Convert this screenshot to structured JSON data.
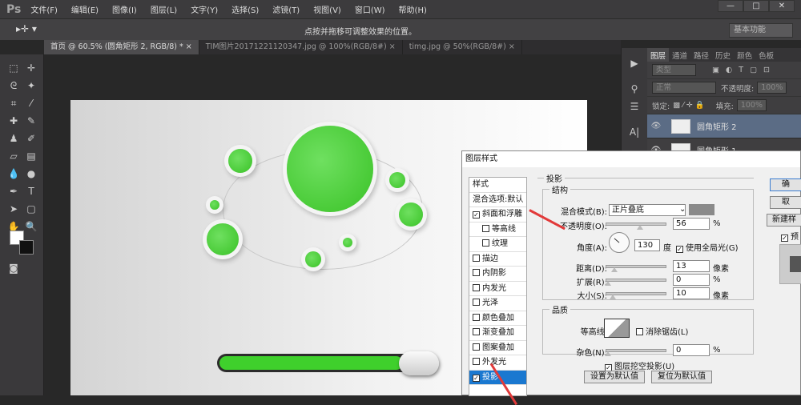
{
  "app": {
    "logo": "Ps",
    "menu": [
      "文件(F)",
      "编辑(E)",
      "图像(I)",
      "图层(L)",
      "文字(Y)",
      "选择(S)",
      "滤镜(T)",
      "视图(V)",
      "窗口(W)",
      "帮助(H)"
    ],
    "window_controls": [
      "—",
      "□",
      "✕"
    ]
  },
  "options": {
    "hint": "点按并拖移可调整效果的位置。",
    "workspace": "基本功能"
  },
  "tabs": [
    {
      "label": "首页 @ 60.5% (圆角矩形 2, RGB/8) *",
      "close": "×"
    },
    {
      "label": "TIM图片20171221120347.jpg @ 100%(RGB/8#)",
      "close": "×"
    },
    {
      "label": "timg.jpg @ 50%(RGB/8#)",
      "close": "×"
    }
  ],
  "canvas": {
    "progress_percent": 85,
    "accent": "#3fd02c"
  },
  "layers_panel": {
    "tabs": [
      "图层",
      "通道",
      "路径",
      "历史",
      "颜色",
      "色板"
    ],
    "filter": "类型",
    "blend": "正常",
    "opacity_label": "不透明度:",
    "opacity": "100%",
    "lock_label": "锁定:",
    "fill_label": "填充:",
    "fill": "100%",
    "layers": [
      {
        "name": "圆角矩形 2",
        "selected": true
      },
      {
        "name": "圆角矩形 1",
        "selected": false
      }
    ]
  },
  "dialog": {
    "title": "图层样式",
    "styles_header": "样式",
    "blend_options": "混合选项:默认",
    "styles": [
      {
        "label": "斜面和浮雕",
        "checked": true,
        "sub": false
      },
      {
        "label": "等高线",
        "checked": false,
        "sub": true
      },
      {
        "label": "纹理",
        "checked": false,
        "sub": true
      },
      {
        "label": "描边",
        "checked": false,
        "sub": false
      },
      {
        "label": "内阴影",
        "checked": false,
        "sub": false
      },
      {
        "label": "内发光",
        "checked": false,
        "sub": false
      },
      {
        "label": "光泽",
        "checked": false,
        "sub": false
      },
      {
        "label": "颜色叠加",
        "checked": false,
        "sub": false
      },
      {
        "label": "渐变叠加",
        "checked": false,
        "sub": false
      },
      {
        "label": "图案叠加",
        "checked": false,
        "sub": false
      },
      {
        "label": "外发光",
        "checked": false,
        "sub": false
      },
      {
        "label": "投影",
        "checked": true,
        "sub": false,
        "selected": true
      }
    ],
    "section": "投影",
    "structure": "结构",
    "blend_mode_label": "混合模式(B):",
    "blend_mode": "正片叠底",
    "shadow_color": "#8a8a8a",
    "opacity_label": "不透明度(O):",
    "opacity": "56",
    "angle_label": "角度(A):",
    "angle": "130",
    "angle_unit": "度",
    "global_light": "使用全局光(G)",
    "distance_label": "距离(D):",
    "distance": "13",
    "spread_label": "扩展(R):",
    "spread": "0",
    "size_label": "大小(S):",
    "size": "10",
    "px": "像素",
    "pct": "%",
    "quality": "品质",
    "contour_label": "等高线:",
    "antialias": "消除锯齿(L)",
    "noise_label": "杂色(N):",
    "noise": "0",
    "knockout": "图层挖空投影(U)",
    "set_default": "设置为默认值",
    "reset_default": "复位为默认值",
    "ok": "确",
    "cancel": "取",
    "new_style": "新建样",
    "preview": "预"
  }
}
